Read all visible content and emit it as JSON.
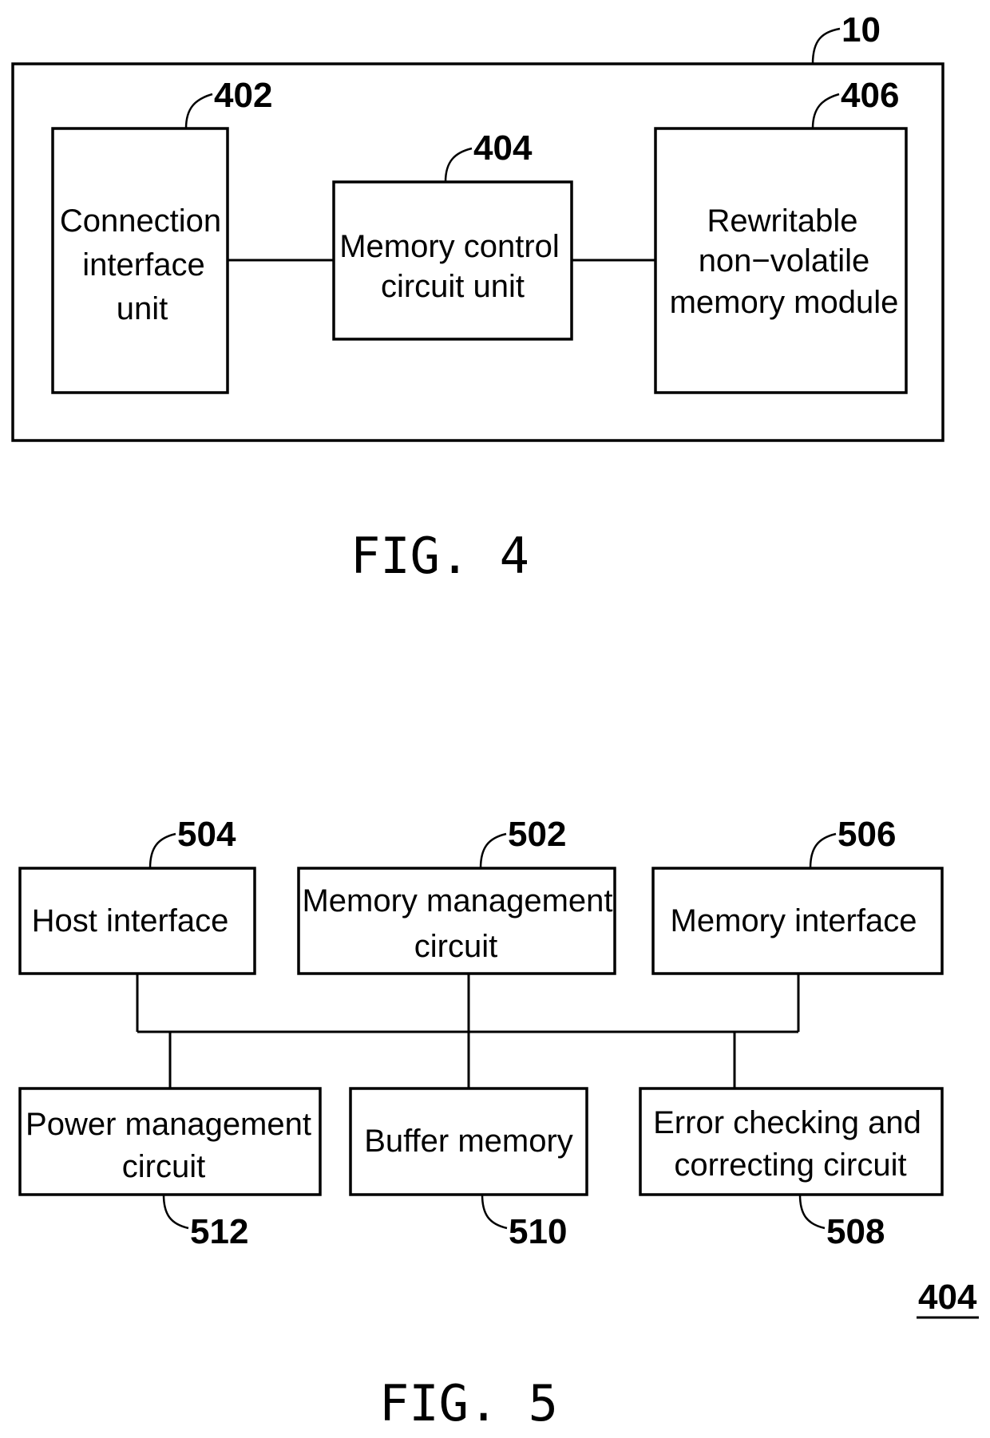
{
  "figure4": {
    "caption": "FIG. 4",
    "device_ref": "10",
    "blocks": [
      {
        "ref": "402",
        "lines": [
          "Connection",
          "interface",
          "unit"
        ]
      },
      {
        "ref": "404",
        "lines": [
          "Memory control",
          "circuit unit"
        ]
      },
      {
        "ref": "406",
        "lines": [
          "Rewritable",
          "non−volatile",
          "memory module"
        ]
      }
    ]
  },
  "figure5": {
    "caption": "FIG. 5",
    "assembly_ref": "404",
    "top_blocks": [
      {
        "ref": "504",
        "lines": [
          "Host interface"
        ]
      },
      {
        "ref": "502",
        "lines": [
          "Memory management",
          "circuit"
        ]
      },
      {
        "ref": "506",
        "lines": [
          "Memory interface"
        ]
      }
    ],
    "bottom_blocks": [
      {
        "ref": "512",
        "lines": [
          "Power management",
          "circuit"
        ]
      },
      {
        "ref": "510",
        "lines": [
          "Buffer memory"
        ]
      },
      {
        "ref": "508",
        "lines": [
          "Error checking and",
          "correcting circuit"
        ]
      }
    ]
  }
}
